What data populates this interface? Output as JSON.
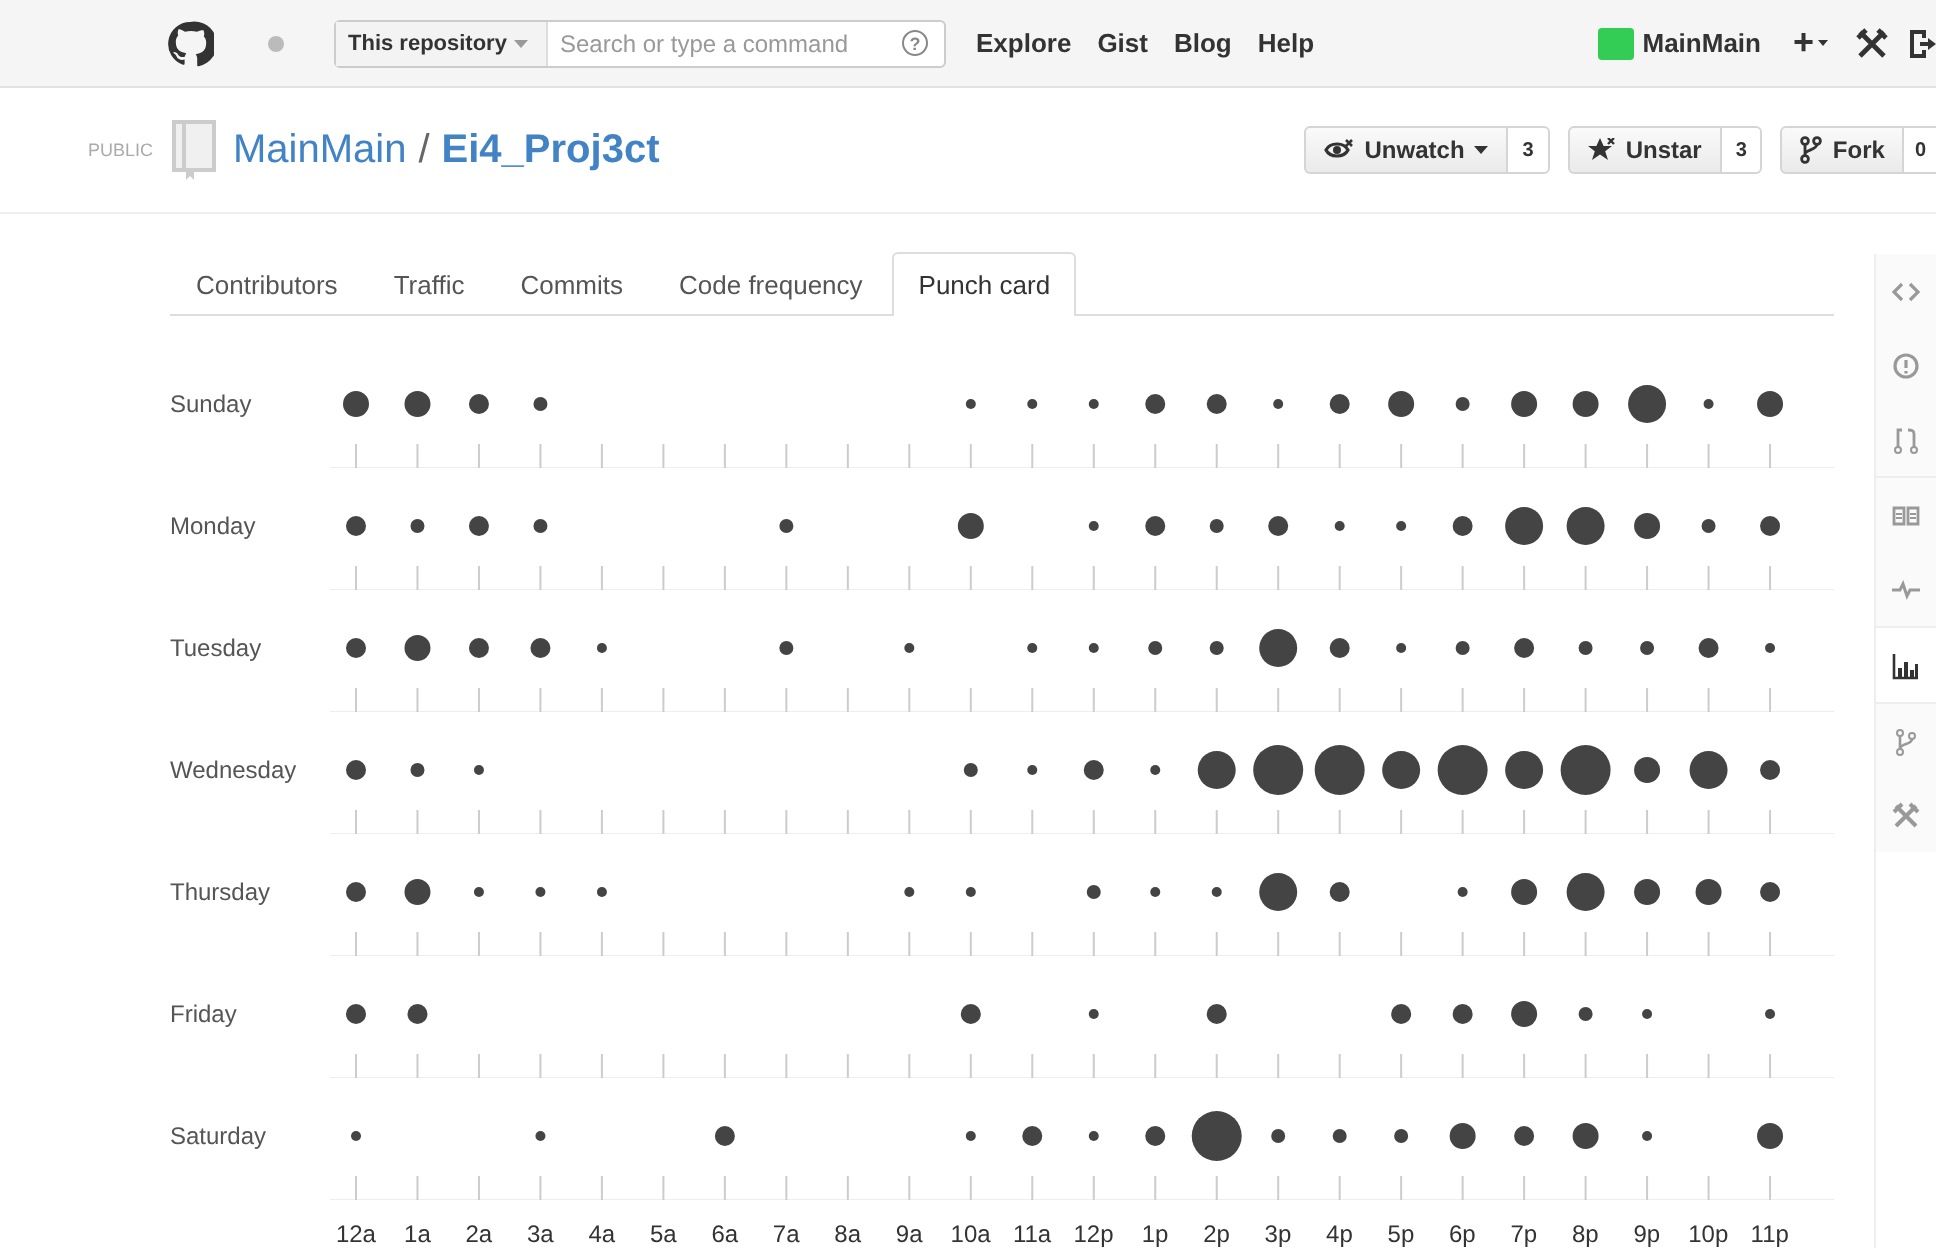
{
  "header": {
    "scope_select": "This repository",
    "search": {
      "placeholder": "Search or type a command",
      "help_icon": "?"
    },
    "nav": [
      "Explore",
      "Gist",
      "Blog",
      "Help"
    ],
    "user": "MainMain",
    "new_menu": "+"
  },
  "repo": {
    "visibility": "PUBLIC",
    "owner": "MainMain",
    "separator": "/",
    "name": "Ei4_Proj3ct",
    "actions": [
      {
        "kind": "watch",
        "label": "Unwatch",
        "count": "3"
      },
      {
        "kind": "star",
        "label": "Unstar",
        "count": "3"
      },
      {
        "kind": "fork",
        "label": "Fork",
        "count": "0"
      }
    ]
  },
  "tabs": [
    {
      "label": "Contributors",
      "selected": false
    },
    {
      "label": "Traffic",
      "selected": false
    },
    {
      "label": "Commits",
      "selected": false
    },
    {
      "label": "Code frequency",
      "selected": false
    },
    {
      "label": "Punch card",
      "selected": true
    }
  ],
  "punch_card": {
    "days": [
      "Sunday",
      "Monday",
      "Tuesday",
      "Wednesday",
      "Thursday",
      "Friday",
      "Saturday"
    ],
    "hours": [
      "12a",
      "1a",
      "2a",
      "3a",
      "4a",
      "5a",
      "6a",
      "7a",
      "8a",
      "9a",
      "10a",
      "11a",
      "12p",
      "1p",
      "2p",
      "3p",
      "4p",
      "5p",
      "6p",
      "7p",
      "8p",
      "9p",
      "10p",
      "11p"
    ]
  },
  "sidebar": [
    {
      "kind": "code",
      "selected": false
    },
    {
      "kind": "issues",
      "selected": false
    },
    {
      "kind": "pulls",
      "selected": false
    },
    {
      "kind": "wiki",
      "selected": false
    },
    {
      "kind": "pulse",
      "selected": false
    },
    {
      "kind": "graphs",
      "selected": true
    },
    {
      "kind": "network",
      "selected": false
    },
    {
      "kind": "settings",
      "selected": false
    }
  ]
}
